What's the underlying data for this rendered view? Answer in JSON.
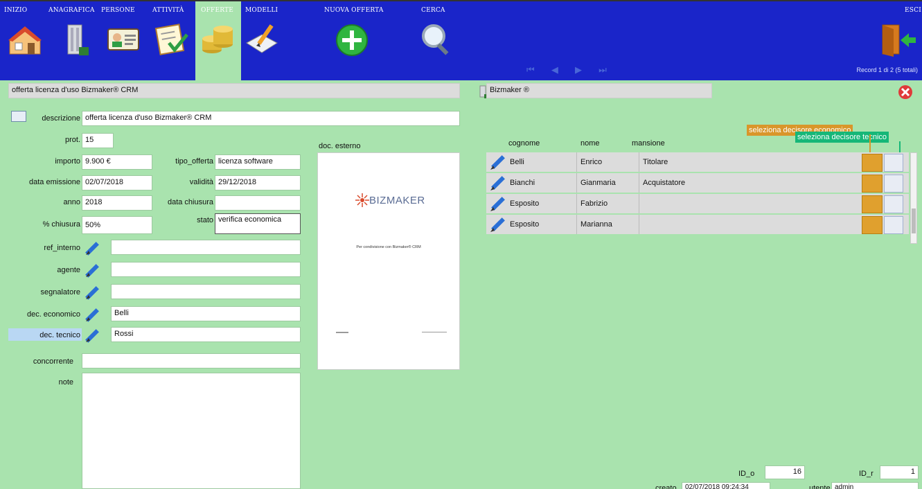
{
  "nav": {
    "items": [
      {
        "label": "Inizio",
        "icon": "house-icon"
      },
      {
        "label": "Anagrafica",
        "icon": "building-icon"
      },
      {
        "label": "Persone",
        "icon": "contact-card-icon"
      },
      {
        "label": "Attività",
        "icon": "checklist-icon"
      },
      {
        "label": "Offerte",
        "icon": "coins-icon"
      },
      {
        "label": "Modelli",
        "icon": "document-pencil-icon"
      }
    ],
    "new_offer": "Nuova offerta",
    "search": "Cerca",
    "exit": "Esci",
    "pager_symbols": "⏮ ◀ ▶ ⏭",
    "record_info": "Record 1 di 2 (5 totali)"
  },
  "header": {
    "title_field": "offerta licenza d'uso Bizmaker® CRM",
    "company_field": "Bizmaker ®"
  },
  "form": {
    "descrizione_label": "descrizione",
    "descrizione_value": "offerta licenza d'uso Bizmaker® CRM",
    "prot_label": "prot.",
    "prot_value": "15",
    "importo_label": "importo",
    "importo_value": "9.900 €",
    "tipo_offerta_label": "tipo_offerta",
    "tipo_offerta_value": "licenza software",
    "data_emissione_label": "data emissione",
    "data_emissione_value": "02/07/2018",
    "validita_label": "validità",
    "validita_value": "29/12/2018",
    "anno_label": "anno",
    "anno_value": "2018",
    "data_chiusura_label": "data chiusura",
    "data_chiusura_value": "",
    "chiusura_label": "% chiusura",
    "chiusura_value": "50%",
    "stato_label": "stato",
    "stato_value": "verifica economica",
    "ref_interno_label": "ref_interno",
    "ref_interno_value": "",
    "agente_label": "agente",
    "agente_value": "",
    "segnalatore_label": "segnalatore",
    "segnalatore_value": "",
    "dec_economico_label": "dec. economico",
    "dec_economico_value": "Belli",
    "dec_tecnico_label": "dec. tecnico",
    "dec_tecnico_value": "Rossi",
    "concorrente_label": "concorrente",
    "concorrente_value": "",
    "note_label": "note",
    "note_value": "",
    "doc_esterno_label": "doc. esterno",
    "doc_brand": "BIZMAKER",
    "doc_caption": "Per condivisione con Bizmaker® CRM"
  },
  "contacts": {
    "tag_tecnico": "seleziona decisore tecnico",
    "tag_economico": "seleziona decisore economico",
    "columns": [
      "cognome",
      "nome",
      "mansione"
    ],
    "rows": [
      {
        "cognome": "Belli",
        "nome": "Enrico",
        "mansione": "Titolare"
      },
      {
        "cognome": "Bianchi",
        "nome": "Gianmaria",
        "mansione": "Acquistatore"
      },
      {
        "cognome": "Esposito",
        "nome": "Fabrizio",
        "mansione": ""
      },
      {
        "cognome": "Esposito",
        "nome": "Marianna",
        "mansione": ""
      }
    ]
  },
  "footer": {
    "id_o_label": "ID_o",
    "id_o_value": "16",
    "id_r_label": "ID_r",
    "id_r_value": "1",
    "creato_label": "creato",
    "creato_value": "02/07/2018 09:24:34",
    "utente_label": "utente",
    "utente_value": "admin"
  },
  "colors": {
    "toolbar_bg": "#1a25c9",
    "form_bg": "#a9e3ae",
    "tag_tecnico": "#16b778",
    "tag_economico": "#d9962a"
  }
}
